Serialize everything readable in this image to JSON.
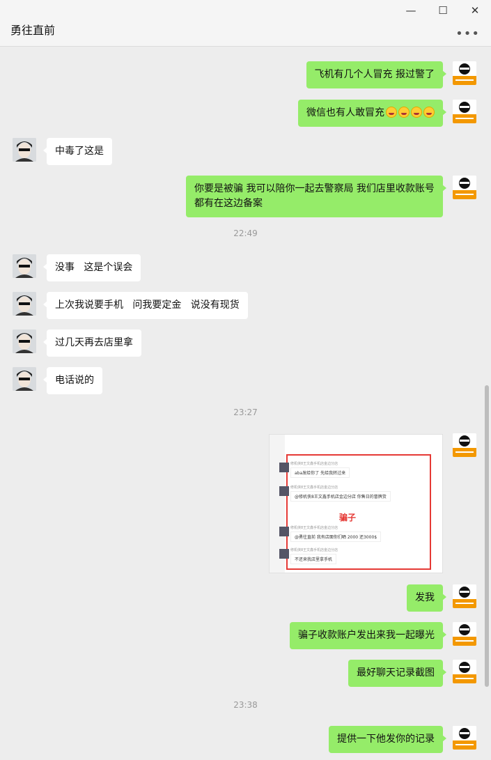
{
  "window": {
    "title": "勇往直前",
    "minimize": "—",
    "maximize": "☐",
    "close": "✕",
    "more": "•••"
  },
  "messages": [
    {
      "side": "self",
      "text": "飞机有几个人冒充 报过警了"
    },
    {
      "side": "self",
      "text": "微信也有人敢冒充",
      "emoji_count": 4,
      "emoji": "laughing-crying-emoji"
    },
    {
      "side": "other",
      "text": "中毒了这是"
    },
    {
      "side": "self",
      "text": "你要是被骗 我可以陪你一起去警察局 我们店里收款账号都有在这边备案"
    },
    {
      "side": "other",
      "text": "没事   这是个误会"
    },
    {
      "side": "other",
      "text": "上次我说要手机   问我要定金   说没有现货"
    },
    {
      "side": "other",
      "text": "过几天再去店里拿"
    },
    {
      "side": "other",
      "text": "电话说的"
    },
    {
      "side": "self",
      "text": "发我"
    },
    {
      "side": "self",
      "text": "骗子收款账户发出来我一起曝光"
    },
    {
      "side": "self",
      "text": "最好聊天记录截图"
    },
    {
      "side": "self",
      "text": "提供一下他发你的记录"
    }
  ],
  "timestamps": [
    "22:49",
    "23:27",
    "23:38"
  ],
  "image_message": {
    "overlay_label": "骗子",
    "highlight_color": "#e53935",
    "rows": [
      {
        "name": "修机侠8王文鑫手机店金边分店",
        "text": "aba发给你了   先给我转过来"
      },
      {
        "name": "修机侠8王文鑫手机店金边分店",
        "text": "@修机侠8王文鑫手机店金边分店 你售日的冒牌货"
      },
      {
        "name": "修机侠8王文鑫手机店金边分店",
        "text": "@勇往直前 我有店面你们晒   2000   还3000$"
      },
      {
        "name": "修机侠8王文鑫手机店金边分店",
        "text": "不还来我店里拿手机"
      }
    ]
  },
  "colors": {
    "self_bubble": "#95ec69",
    "other_bubble": "#ffffff",
    "background": "#ededed"
  }
}
